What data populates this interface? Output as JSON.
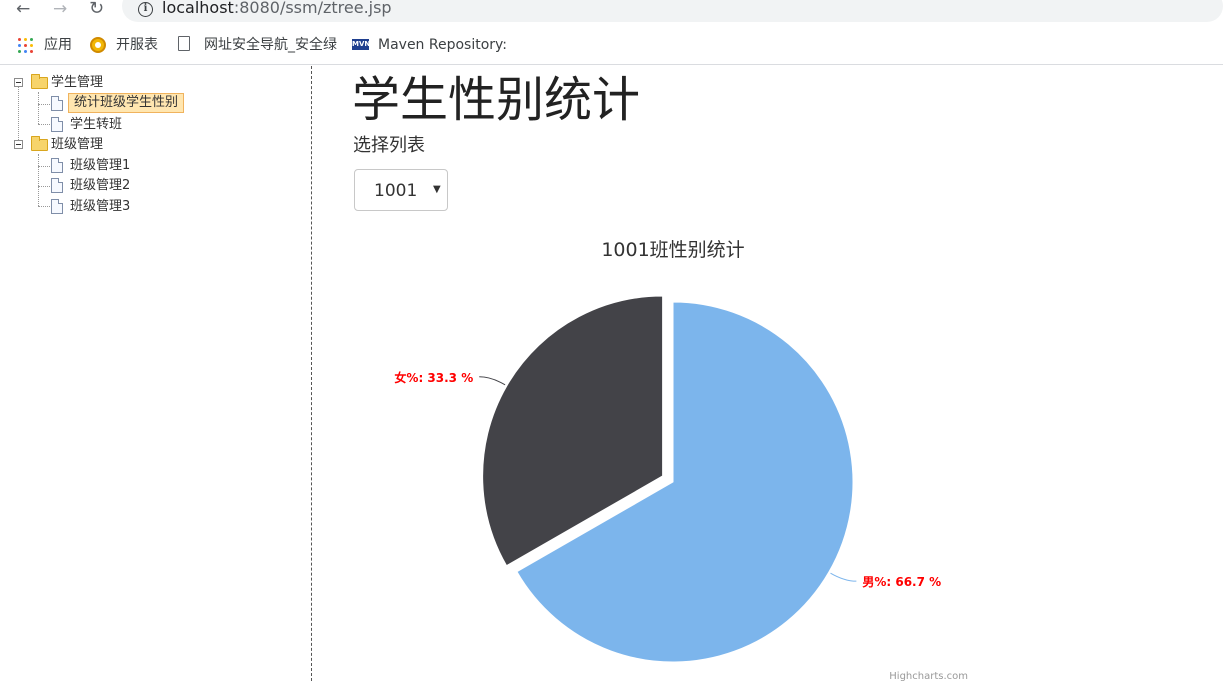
{
  "browser": {
    "url_host": "localhost",
    "url_path": ":8080/ssm/ztree.jsp",
    "bookmarks": [
      {
        "label": "应用"
      },
      {
        "label": "开服表"
      },
      {
        "label": "网址安全导航_安全绿"
      },
      {
        "label": "Maven Repository:"
      }
    ],
    "apps_colors": [
      "#ea4335",
      "#fbbc05",
      "#34a853",
      "#4285f4",
      "#ea4335",
      "#fbbc05",
      "#34a853",
      "#4285f4",
      "#ea4335"
    ]
  },
  "tree": {
    "nodes": [
      {
        "label": "学生管理",
        "type": "folder"
      },
      {
        "label": "统计班级学生性别",
        "type": "leaf",
        "selected": true
      },
      {
        "label": "学生转班",
        "type": "leaf"
      },
      {
        "label": "班级管理",
        "type": "folder"
      },
      {
        "label": "班级管理1",
        "type": "leaf"
      },
      {
        "label": "班级管理2",
        "type": "leaf"
      },
      {
        "label": "班级管理3",
        "type": "leaf"
      }
    ]
  },
  "main": {
    "title": "学生性别统计",
    "select_label": "选择列表",
    "select_value": "1001"
  },
  "chart_data": {
    "type": "pie",
    "title": "1001班性别统计",
    "credits": "Highcharts.com",
    "slices": [
      {
        "name": "男%",
        "value": 66.7,
        "label": "男%: 66.7 %",
        "color": "#7cb5ec",
        "sliced": false
      },
      {
        "name": "女%",
        "value": 33.3,
        "label": "女%: 33.3 %",
        "color": "#434348",
        "sliced": true
      }
    ],
    "label_color": "#ff0000"
  }
}
